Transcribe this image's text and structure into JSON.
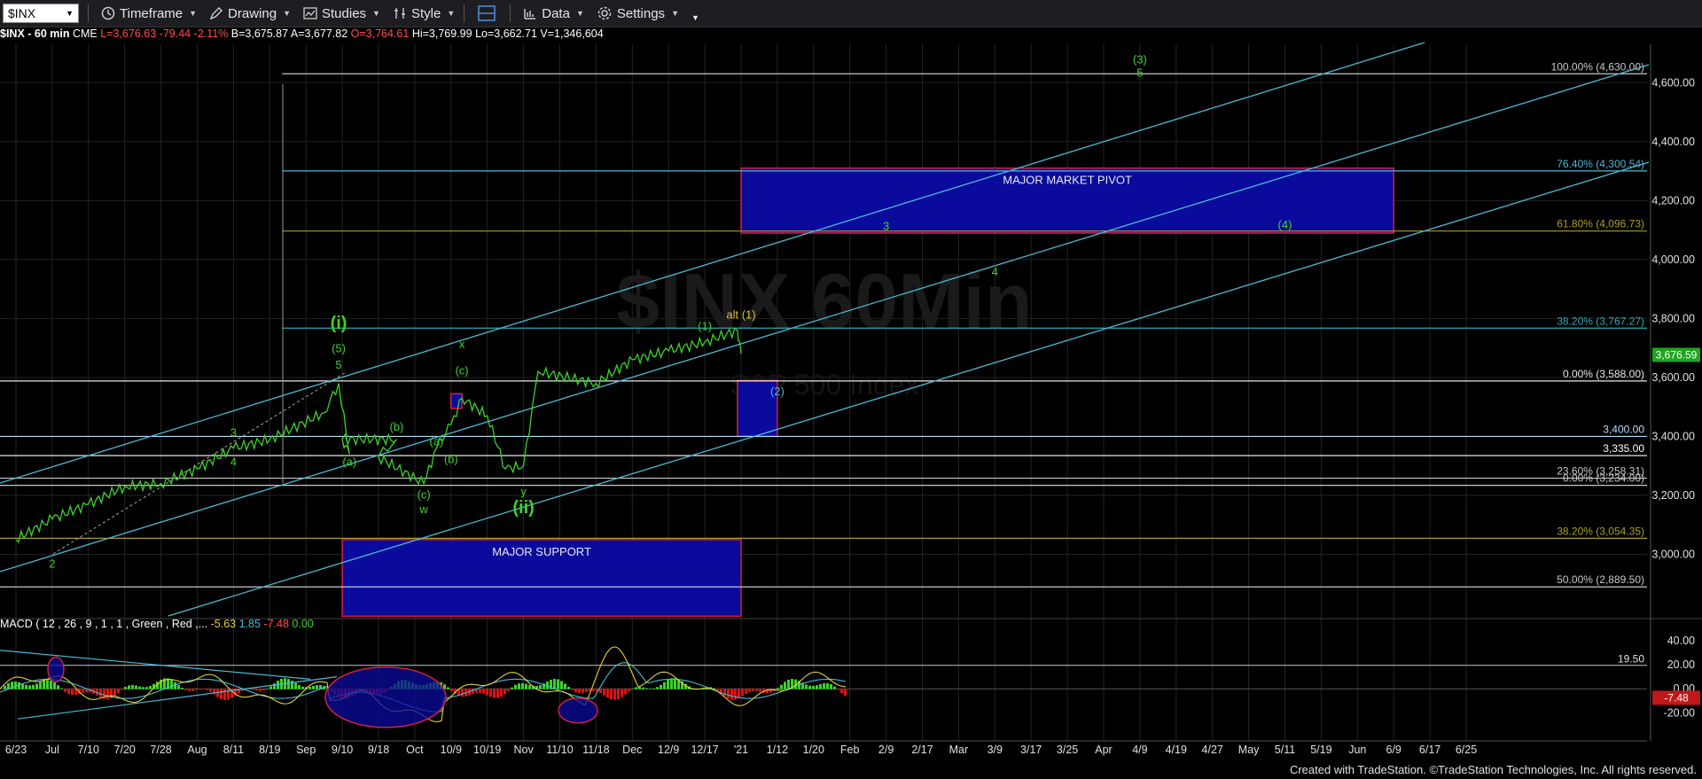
{
  "toolbar": {
    "symbol": "$INX",
    "timeframe": "Timeframe",
    "drawing": "Drawing",
    "studies": "Studies",
    "style": "Style",
    "data": "Data",
    "settings": "Settings",
    "icons": [
      "clock-icon",
      "pencil-icon",
      "studies-icon",
      "style-icon",
      "layout-icon",
      "bar-chart-icon",
      "gear-icon"
    ]
  },
  "infobar": {
    "symbol": "$INX - 60 min",
    "exchange": "CME",
    "last": "L=3,676.63",
    "change": "-79.44",
    "pct": "-2.11%",
    "bid": "B=3,675.87",
    "ask": "A=3,677.82",
    "open": "O=3,764.61",
    "high": "Hi=3,769.99",
    "low": "Lo=3,662.71",
    "volume": "V=1,346,604"
  },
  "watermark": {
    "title": "$INX 60Min",
    "subtitle": "S&P 500 Index"
  },
  "chart_data": [
    {
      "type": "line",
      "title": "$INX - 60 min",
      "price_axis": {
        "ylim": [
          2800,
          4700
        ],
        "ticks": [
          "4,600.00",
          "4,400.00",
          "4,200.00",
          "4,000.00",
          "3,800.00",
          "3,600.00",
          "3,400.00",
          "3,200.00",
          "3,000.00"
        ],
        "tick_values": [
          4600,
          4400,
          4200,
          4000,
          3800,
          3600,
          3400,
          3200,
          3000
        ]
      },
      "last_price_label": "3,676.59",
      "time_axis_labels": [
        "6/23",
        "Jul",
        "7/10",
        "7/20",
        "7/28",
        "Aug",
        "8/11",
        "8/19",
        "Sep",
        "9/10",
        "9/18",
        "Oct",
        "10/9",
        "10/19",
        "Nov",
        "11/10",
        "11/18",
        "Dec",
        "12/9",
        "12/17",
        "'21",
        "1/12",
        "1/20",
        "Feb",
        "2/9",
        "2/17",
        "Mar",
        "3/9",
        "3/17",
        "3/25",
        "Apr",
        "4/9",
        "4/19",
        "4/27",
        "May",
        "5/11",
        "5/19",
        "Jun",
        "6/9",
        "6/17",
        "6/25"
      ],
      "series": [
        {
          "name": "$INX",
          "color": "#3cd22a",
          "points": [
            [
              "6/23",
              3050
            ],
            [
              "Jul",
              3120
            ],
            [
              "7/10",
              3170
            ],
            [
              "7/20",
              3230
            ],
            [
              "7/28",
              3240
            ],
            [
              "Aug",
              3290
            ],
            [
              "8/11",
              3360
            ],
            [
              "8/19",
              3390
            ],
            [
              "8/26",
              3480
            ],
            [
              "9/2",
              3580
            ],
            [
              "9/8",
              3340
            ],
            [
              "9/10",
              3390
            ],
            [
              "9/15",
              3390
            ],
            [
              "9/18",
              3330
            ],
            [
              "9/23",
              3240
            ],
            [
              "9/30",
              3360
            ],
            [
              "10/9",
              3440
            ],
            [
              "10/12",
              3530
            ],
            [
              "10/19",
              3470
            ],
            [
              "10/28",
              3290
            ],
            [
              "Nov",
              3300
            ],
            [
              "11/9",
              3620
            ],
            [
              "11/18",
              3580
            ],
            [
              "Dec",
              3660
            ],
            [
              "12/9",
              3690
            ],
            [
              "12/17",
              3720
            ],
            [
              "12/31",
              3760
            ],
            [
              "'21",
              3680
            ]
          ]
        }
      ],
      "horizontal_levels": [
        {
          "label": "100.00% (4,630.00)",
          "value": 4630,
          "color": "#c8c8c8"
        },
        {
          "label": "76.40% (4,300.54)",
          "value": 4300.54,
          "color": "#4ab9d6"
        },
        {
          "label": "61.80% (4,096.73)",
          "value": 4096.73,
          "color": "#a8a020"
        },
        {
          "label": "38.20% (3,767.27)",
          "value": 3767.27,
          "color": "#2aa8b0"
        },
        {
          "label": "0.00% (3,588.00)",
          "value": 3588,
          "color": "#e8e8e8"
        },
        {
          "label": "3,400.00",
          "value": 3400,
          "color": "#b4dcf4"
        },
        {
          "label": "3,335.00",
          "value": 3335,
          "color": "#ffffff"
        },
        {
          "label": "23.60% (3,258.31)",
          "value": 3258.31,
          "color": "#c8c8c8"
        },
        {
          "label": "0.00% (3,234.00)",
          "value": 3234,
          "color": "#c8c8c8"
        },
        {
          "label": "38.20% (3,054.35)",
          "value": 3054.35,
          "color": "#a8a020"
        },
        {
          "label": "50.00% (2,889.50)",
          "value": 2889.5,
          "color": "#c8c8c8"
        }
      ],
      "zones": [
        {
          "label": "MAJOR MARKET PIVOT",
          "top": 4310,
          "bottom": 4090,
          "from": "'21",
          "to": "6/9"
        },
        {
          "label": "MAJOR SUPPORT",
          "top": 3050,
          "bottom": 2790,
          "from": "9/10",
          "to": "'21"
        },
        {
          "label": "",
          "top": 3590,
          "bottom": 3400,
          "from": "12/31",
          "to": "1/12"
        },
        {
          "label": "",
          "top": 3545,
          "bottom": 3495,
          "from": "10/9",
          "to": "10/12"
        }
      ],
      "wave_labels": [
        {
          "text": "(3)",
          "at": "4/9",
          "price": 4665,
          "color": "#3cd22a"
        },
        {
          "text": "5",
          "at": "4/9",
          "price": 4620,
          "color": "#3cd22a"
        },
        {
          "text": "3",
          "at": "2/9",
          "price": 4100,
          "color": "#3cd22a"
        },
        {
          "text": "(4)",
          "at": "5/11",
          "price": 4105,
          "color": "#3cd22a"
        },
        {
          "text": "4",
          "at": "3/9",
          "price": 3945,
          "color": "#3cd22a"
        },
        {
          "text": "alt (1)",
          "at": "'21",
          "price": 3800,
          "color": "#e0c040"
        },
        {
          "text": "(1)",
          "at": "12/17",
          "price": 3760,
          "color": "#3cd22a"
        },
        {
          "text": "(2)",
          "at": "1/12",
          "price": 3540,
          "color": "#4ab9d6"
        },
        {
          "text": "(i)",
          "at": "9/2",
          "price": 3765,
          "color": "#3cd22a"
        },
        {
          "text": "(5)",
          "at": "9/2",
          "price": 3685,
          "color": "#3cd22a"
        },
        {
          "text": "5",
          "at": "9/2",
          "price": 3630,
          "color": "#3cd22a"
        },
        {
          "text": "x",
          "at": "10/12",
          "price": 3700,
          "color": "#3cd22a"
        },
        {
          "text": "(c)",
          "at": "10/12",
          "price": 3610,
          "color": "#3cd22a"
        },
        {
          "text": "(b)",
          "at": "9/15",
          "price": 3420,
          "color": "#3cd22a"
        },
        {
          "text": "(a)",
          "at": "9/8",
          "price": 3300,
          "color": "#3cd22a"
        },
        {
          "text": "(c)",
          "at": "9/23",
          "price": 3190,
          "color": "#3cd22a"
        },
        {
          "text": "w",
          "at": "9/23",
          "price": 3140,
          "color": "#3cd22a"
        },
        {
          "text": "(a)",
          "at": "9/30",
          "price": 3370,
          "color": "#3cd22a"
        },
        {
          "text": "(b)",
          "at": "10/9",
          "price": 3310,
          "color": "#3cd22a"
        },
        {
          "text": "y",
          "at": "Nov",
          "price": 3200,
          "color": "#3cd22a"
        },
        {
          "text": "(ii)",
          "at": "Nov",
          "price": 3140,
          "color": "#3cd22a"
        },
        {
          "text": "3",
          "at": "8/11",
          "price": 3400,
          "color": "#3cd22a"
        },
        {
          "text": "4",
          "at": "8/11",
          "price": 3300,
          "color": "#3cd22a"
        },
        {
          "text": "2",
          "at": "Jul",
          "price": 2955,
          "color": "#3cd22a"
        }
      ]
    },
    {
      "type": "line",
      "title": "MACD",
      "legend": {
        "name": "MACD ( 12 , 26 , 9 , 1 , 1 , Green , Red ,...",
        "v1": "-5.63",
        "v2": "1.85",
        "v3": "-7.48",
        "v4": "0.00"
      },
      "ylim": [
        -30,
        48
      ],
      "ticks": [
        "40.00",
        "20.00",
        "0.00",
        "-20.00"
      ],
      "tick_values": [
        40,
        20,
        0,
        -20
      ],
      "reference_label": "19.50",
      "reference_value": 19.5,
      "current_label": "-7.48"
    }
  ],
  "footer": {
    "credit": "Created with TradeStation. ©TradeStation Technologies, Inc. All rights reserved."
  },
  "colors": {
    "background": "#000000",
    "price": "#3cd22a",
    "channel": "#4ab9d6",
    "zone_fill": "#0a0a9c",
    "zone_border": "#d02040"
  }
}
